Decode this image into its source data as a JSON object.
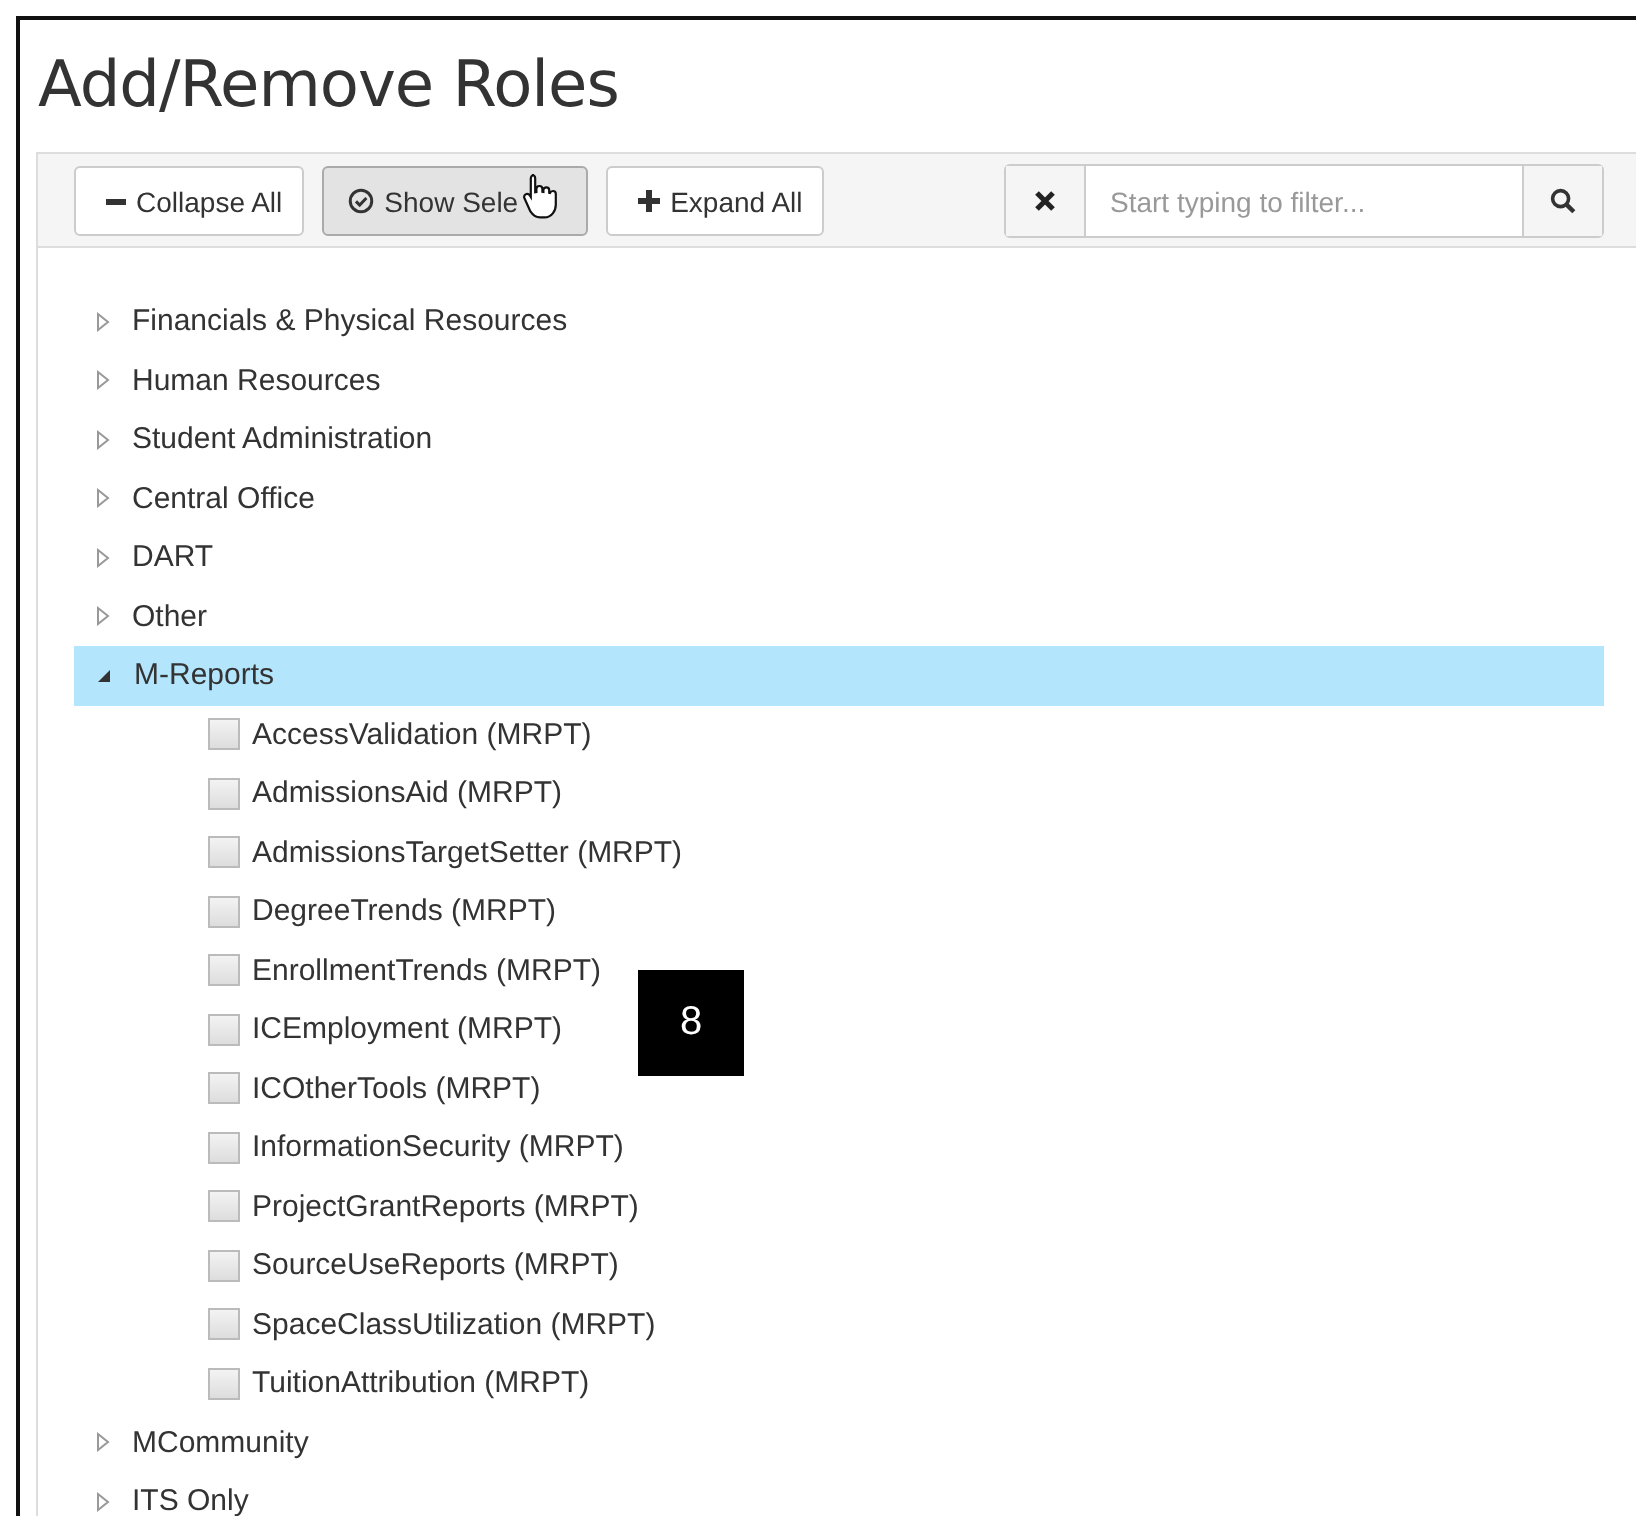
{
  "title": "Add/Remove Roles",
  "toolbar": {
    "buttons": [
      {
        "kind": "collapse",
        "label": "Collapse All",
        "pressed": false
      },
      {
        "kind": "show-selected",
        "label": "Show Sele",
        "pressed": true
      },
      {
        "kind": "expand",
        "label": "Expand All",
        "pressed": false
      }
    ],
    "filter": {
      "placeholder": "Start typing to filter..."
    }
  },
  "tree": [
    {
      "label": "Financials & Physical Resources",
      "expanded": false,
      "selected": false
    },
    {
      "label": "Human Resources",
      "expanded": false,
      "selected": false
    },
    {
      "label": "Student Administration",
      "expanded": false,
      "selected": false
    },
    {
      "label": "Central Office",
      "expanded": false,
      "selected": false
    },
    {
      "label": "DART",
      "expanded": false,
      "selected": false
    },
    {
      "label": "Other",
      "expanded": false,
      "selected": false
    },
    {
      "label": "M-Reports",
      "expanded": true,
      "selected": true,
      "children": [
        {
          "label": "AccessValidation (MRPT)",
          "checked": false
        },
        {
          "label": "AdmissionsAid (MRPT)",
          "checked": false
        },
        {
          "label": "AdmissionsTargetSetter (MRPT)",
          "checked": false
        },
        {
          "label": "DegreeTrends (MRPT)",
          "checked": false
        },
        {
          "label": "EnrollmentTrends (MRPT)",
          "checked": false
        },
        {
          "label": "ICEmployment (MRPT)",
          "checked": false
        },
        {
          "label": "ICOtherTools (MRPT)",
          "checked": false
        },
        {
          "label": "InformationSecurity (MRPT)",
          "checked": false
        },
        {
          "label": "ProjectGrantReports (MRPT)",
          "checked": false
        },
        {
          "label": "SourceUseReports (MRPT)",
          "checked": false
        },
        {
          "label": "SpaceClassUtilization (MRPT)",
          "checked": false
        },
        {
          "label": "TuitionAttribution (MRPT)",
          "checked": false
        }
      ]
    },
    {
      "label": "MCommunity",
      "expanded": false,
      "selected": false
    },
    {
      "label": "ITS Only",
      "expanded": false,
      "selected": false
    }
  ],
  "callout": "8"
}
